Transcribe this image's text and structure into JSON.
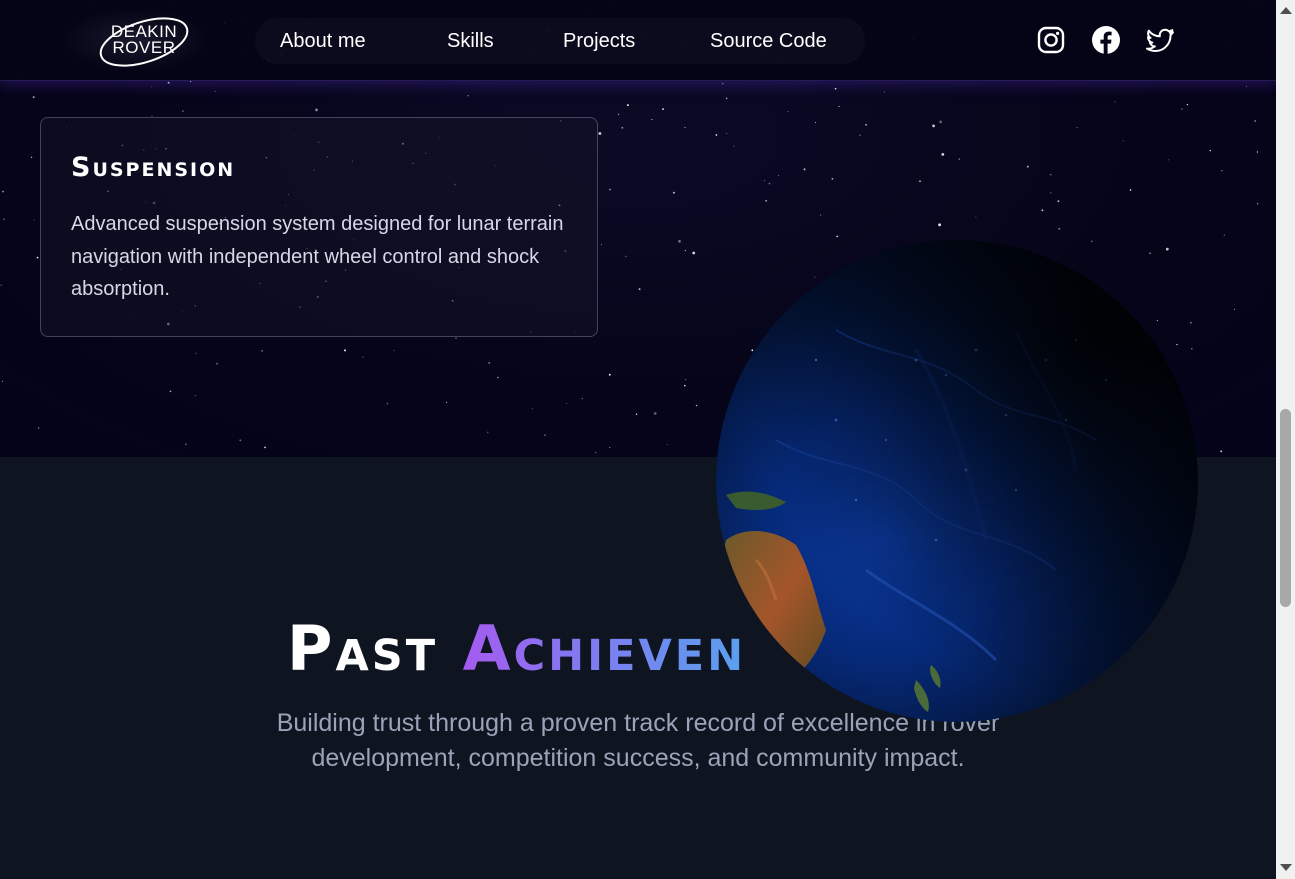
{
  "brand": {
    "line1": "DEAKIN",
    "line2": "ROVER"
  },
  "nav": {
    "links": [
      {
        "label": "About me"
      },
      {
        "label": "Skills"
      },
      {
        "label": "Projects"
      },
      {
        "label": "Source Code"
      }
    ],
    "social": [
      "instagram-icon",
      "facebook-icon",
      "twitter-icon"
    ]
  },
  "card": {
    "title": "Suspension",
    "text": "Advanced suspension system designed for lunar terrain navigation with independent wheel control and shock absorption."
  },
  "achievements": {
    "heading_part1": "Past",
    "heading_part2": "Achieven",
    "subtitle": "Building trust through a proven track record of excellence in rover development, competition success, and community impact."
  },
  "colors": {
    "space_bg": "#04031a",
    "section_bg": "#0e1420",
    "gradient_start": "#a55bf0",
    "gradient_end": "#5aa0ef",
    "subtitle": "#9aa3b8"
  }
}
